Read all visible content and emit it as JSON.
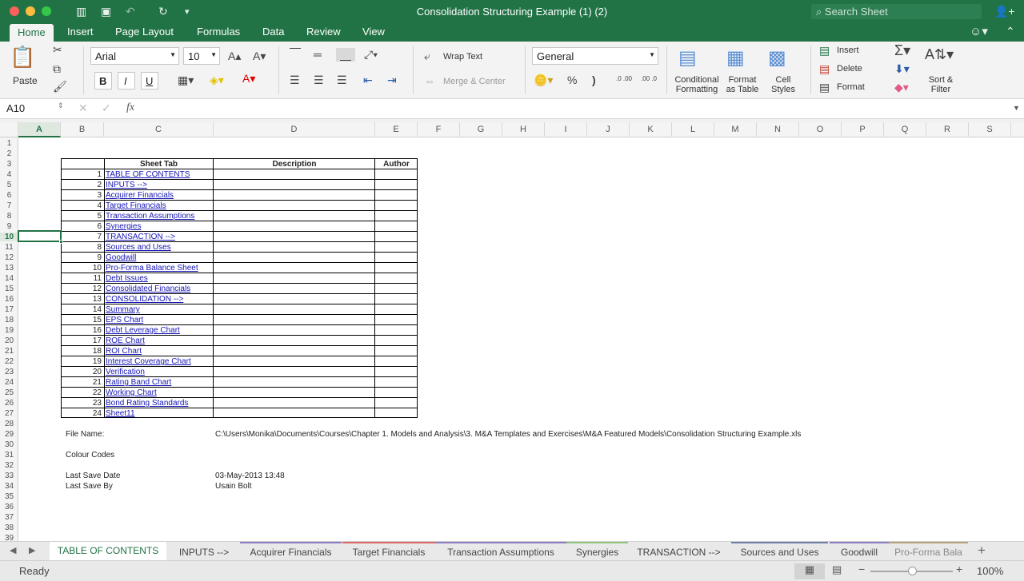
{
  "window": {
    "title": "Consolidation Structuring Example (1) (2)",
    "search_placeholder": "Search Sheet"
  },
  "ribbon_tabs": [
    "Home",
    "Insert",
    "Page Layout",
    "Formulas",
    "Data",
    "Review",
    "View"
  ],
  "ribbon": {
    "paste": "Paste",
    "font_name": "Arial",
    "font_size": "10",
    "wrap_text": "Wrap Text",
    "merge_center": "Merge & Center",
    "number_format": "General",
    "percent": "%",
    "comma": ")",
    "inc_decimal": ".0 .00",
    "dec_decimal": ".00 .0",
    "bold": "B",
    "italic": "I",
    "underline": "U",
    "conditional_formatting": [
      "Conditional",
      "Formatting"
    ],
    "format_as_table": [
      "Format",
      "as Table"
    ],
    "cell_styles": [
      "Cell",
      "Styles"
    ],
    "insert": "Insert",
    "delete": "Delete",
    "format": "Format",
    "sort_filter": [
      "Sort &",
      "Filter"
    ]
  },
  "formula_bar": {
    "name_box": "A10",
    "fx": "fx",
    "value": ""
  },
  "columns": [
    "A",
    "B",
    "C",
    "D",
    "E",
    "F",
    "G",
    "H",
    "I",
    "J",
    "K",
    "L",
    "M",
    "N",
    "O",
    "P",
    "Q",
    "R",
    "S"
  ],
  "rows": [
    "1",
    "2",
    "3",
    "4",
    "5",
    "6",
    "7",
    "8",
    "9",
    "10",
    "11",
    "12",
    "13",
    "14",
    "15",
    "16",
    "17",
    "18",
    "19",
    "20",
    "21",
    "22",
    "23",
    "24",
    "25",
    "26",
    "27",
    "28",
    "29",
    "30",
    "31",
    "32",
    "33",
    "34",
    "35",
    "36",
    "37",
    "38",
    "39"
  ],
  "table": {
    "headers": {
      "sheet_tab": "Sheet Tab",
      "description": "Description",
      "author": "Author"
    },
    "entries": [
      {
        "n": "1",
        "tab": "TABLE OF CONTENTS"
      },
      {
        "n": "2",
        "tab": "INPUTS -->"
      },
      {
        "n": "3",
        "tab": "Acquirer Financials"
      },
      {
        "n": "4",
        "tab": "Target Financials"
      },
      {
        "n": "5",
        "tab": "Transaction Assumptions"
      },
      {
        "n": "6",
        "tab": "Synergies"
      },
      {
        "n": "7",
        "tab": "TRANSACTION -->"
      },
      {
        "n": "8",
        "tab": "Sources and Uses"
      },
      {
        "n": "9",
        "tab": "Goodwill"
      },
      {
        "n": "10",
        "tab": "Pro-Forma Balance Sheet"
      },
      {
        "n": "11",
        "tab": "Debt Issues"
      },
      {
        "n": "12",
        "tab": "Consolidated Financials"
      },
      {
        "n": "13",
        "tab": "CONSOLIDATION -->"
      },
      {
        "n": "14",
        "tab": "Summary"
      },
      {
        "n": "15",
        "tab": "EPS Chart"
      },
      {
        "n": "16",
        "tab": "Debt Leverage Chart"
      },
      {
        "n": "17",
        "tab": "ROE Chart"
      },
      {
        "n": "18",
        "tab": "ROI Chart"
      },
      {
        "n": "19",
        "tab": "Interest Coverage Chart"
      },
      {
        "n": "20",
        "tab": "Verification"
      },
      {
        "n": "21",
        "tab": "Rating Band Chart"
      },
      {
        "n": "22",
        "tab": "Working Chart"
      },
      {
        "n": "23",
        "tab": "Bond Rating Standards"
      },
      {
        "n": "24",
        "tab": "Sheet11"
      }
    ]
  },
  "info": {
    "file_name_label": "File Name:",
    "file_name": "C:\\Users\\Monika\\Documents\\Courses\\Chapter 1. Models and Analysis\\3. M&A Templates and Exercises\\M&A Featured Models\\Consolidation Structuring Example.xls",
    "colour_codes_label": "Colour Codes",
    "last_save_date_label": "Last Save Date",
    "last_save_date": "03-May-2013 13:48",
    "last_save_by_label": "Last Save By",
    "last_save_by": "Usain Bolt"
  },
  "sheet_tabs": [
    {
      "label": "TABLE OF CONTENTS",
      "color": ""
    },
    {
      "label": "INPUTS -->",
      "color": ""
    },
    {
      "label": "Acquirer Financials",
      "color": "#8e7cc3"
    },
    {
      "label": "Target Financials",
      "color": "#e06666"
    },
    {
      "label": "Transaction Assumptions",
      "color": "#8e7cc3"
    },
    {
      "label": "Synergies",
      "color": "#93c47d"
    },
    {
      "label": "TRANSACTION -->",
      "color": ""
    },
    {
      "label": "Sources and Uses",
      "color": "#6d7fa8"
    },
    {
      "label": "Goodwill",
      "color": "#8e7cc3"
    },
    {
      "label": "Pro-Forma Bala",
      "color": "#b7a27a"
    }
  ],
  "status": {
    "ready": "Ready",
    "zoom": "100%",
    "zoom_fraction": 0.5
  },
  "colors": {
    "brand": "#217346",
    "link": "#1515b6"
  }
}
